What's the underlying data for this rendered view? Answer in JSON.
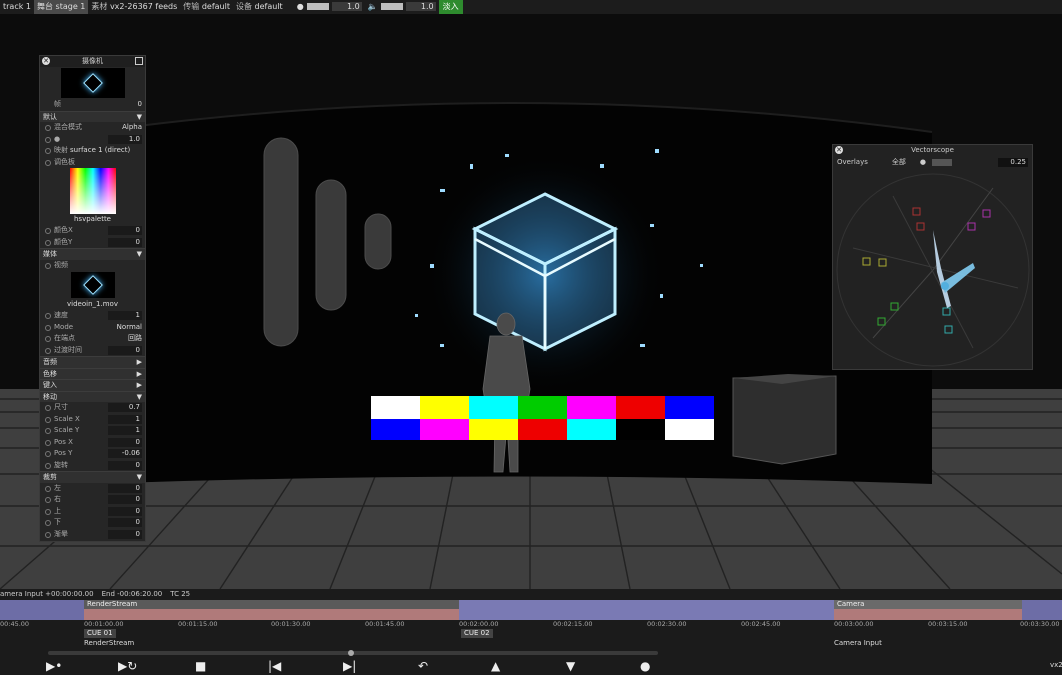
{
  "topbar": {
    "track": "track 1",
    "stage_label": "舞台",
    "stage": "stage 1",
    "media_label": "素材",
    "feeds": "vx2-26367 feeds",
    "transport_label": "传输",
    "transport": "default",
    "device_label": "设备",
    "device": "default",
    "brightness": "1.0",
    "volume": "1.0",
    "fade": "淡入"
  },
  "camera_panel": {
    "title": "摄像机",
    "frame_label": "帧",
    "frame_value": "0",
    "default_section": "默认",
    "blend_label": "混合模式",
    "blend_value": "Alpha",
    "brightness_value": "1.0",
    "mapping_label": "映射",
    "mapping_value": "surface 1 (direct)",
    "palette_label": "调色板",
    "palette_name": "hsvpalette",
    "color_x_label": "颜色X",
    "color_x_value": "0",
    "color_y_label": "颜色Y",
    "color_y_value": "0",
    "media_section": "媒体",
    "video_label": "视频",
    "video_file": "videoin_1.mov",
    "speed_label": "速度",
    "speed_value": "1",
    "mode_label": "Mode",
    "mode_value": "Normal",
    "at_end_label": "在端点",
    "at_end_value": "回路",
    "transition_label": "过渡时间",
    "transition_value": "0",
    "audio_section": "音频",
    "color_shift_section": "色移",
    "keying_section": "键入",
    "move_section": "移动",
    "size_label": "尺寸",
    "size_value": "0.7",
    "scale_x_label": "Scale X",
    "scale_x_value": "1",
    "scale_y_label": "Scale Y",
    "scale_y_value": "1",
    "pos_x_label": "Pos X",
    "pos_x_value": "0",
    "pos_y_label": "Pos Y",
    "pos_y_value": "-0.06",
    "rotate_label": "旋转",
    "rotate_value": "0",
    "crop_section": "裁剪",
    "left_label": "左",
    "left_value": "0",
    "right_label": "右",
    "right_value": "0",
    "top_label": "上",
    "top_value": "0",
    "bottom_label": "下",
    "bottom_value": "0",
    "feather_label": "渐晕",
    "feather_value": "0"
  },
  "vectorscope": {
    "title": "Vectorscope",
    "overlays_label": "Overlays",
    "overlays_value": "全部",
    "gain_value": "0.25"
  },
  "timeline": {
    "source": "amera Input +00:00:00.00",
    "end": "End -00:06:20.00",
    "tc": "TC 25",
    "seg_render": "RenderStream",
    "seg_camera": "Camera",
    "ticks": [
      "00:45.00",
      "00:01:00.00",
      "00:01:15.00",
      "00:01:30.00",
      "00:01:45.00",
      "00:02:00.00",
      "00:02:15.00",
      "00:02:30.00",
      "00:02:45.00",
      "00:03:00.00",
      "00:03:15.00",
      "00:03:30.00"
    ],
    "cue1": "CUE 01",
    "cue2": "CUE 02",
    "sub1": "RenderStream",
    "sub2": "Camera Input",
    "corner": "vx2"
  },
  "colors": {
    "fade_button": "#2e8b2e",
    "track_pink": "#c98b8b",
    "track_blue": "#8b8bc9"
  }
}
